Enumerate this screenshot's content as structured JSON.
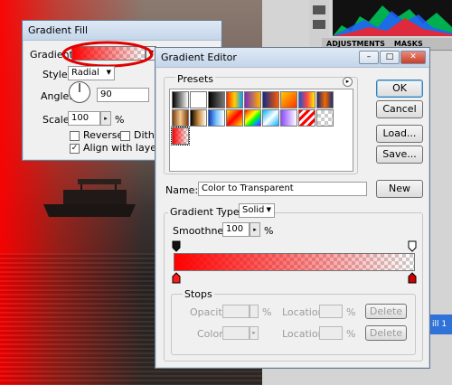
{
  "gradient_fill": {
    "title": "Gradient Fill",
    "gradient_label": "Gradient:",
    "style_label": "Style:",
    "style_value": "Radial",
    "angle_label": "Angle:",
    "angle_value": "90",
    "scale_label": "Scale:",
    "scale_value": "100",
    "scale_unit": "%",
    "reverse_label": "Reverse",
    "dither_label": "Dither",
    "align_label": "Align with layer",
    "reverse_checked": false,
    "dither_checked": false,
    "align_checked": true
  },
  "gradient_editor": {
    "title": "Gradient Editor",
    "presets_label": "Presets",
    "ok_label": "OK",
    "cancel_label": "Cancel",
    "load_label": "Load...",
    "save_label": "Save...",
    "name_label": "Name:",
    "name_value": "Color to Transparent",
    "new_label": "New",
    "gradient_type_label": "Gradient Type:",
    "gradient_type_value": "Solid",
    "smoothness_label": "Smoothness:",
    "smoothness_value": "100",
    "smoothness_unit": "%",
    "stops_label": "Stops",
    "opacity_label": "Opacity:",
    "opacity_unit": "%",
    "location_label": "Location:",
    "location_unit": "%",
    "color_label": "Color:",
    "delete_label": "Delete",
    "preset_swatches": [
      "linear-gradient(90deg,#000,#fff)",
      "linear-gradient(90deg,#fff,rgba(255,255,255,0))",
      "linear-gradient(90deg,#000,#777)",
      "linear-gradient(90deg,#ff2b00,#ffd000,#00a0ff)",
      "linear-gradient(90deg,#7a2cc0,#ffb100)",
      "linear-gradient(90deg,#0f2a8a,#ff5a00)",
      "linear-gradient(135deg,#ffcc00,#ff3300)",
      "linear-gradient(90deg,#1a53d6,#ff4444,#ffee00)",
      "linear-gradient(90deg,#1d2a70,#f26a00,#1d2a70)",
      "linear-gradient(90deg,#7c3e0f,#f5c98f,#7c3e0f)",
      "linear-gradient(90deg,#000,#c98a3a,#fff)",
      "linear-gradient(90deg,#0a3fbf,#7dc4ff,#fff)",
      "linear-gradient(135deg,#ffe400,#ff0000,#ffe400)",
      "linear-gradient(135deg,#ff0000,#ff9900,#ffff00,#00ff00,#0099ff,#9900ff)",
      "linear-gradient(135deg,#00b3ff,#fff,#00b3ff)",
      "linear-gradient(90deg,#8f4aff,#fff)",
      "repeating-linear-gradient(135deg,#ff0000 0,#ff0000 3px,#fff 3px,#fff 6px)",
      "checker",
      "linear-gradient(90deg,#ff0000,rgba(255,0,0,0))"
    ]
  },
  "right_panel": {
    "tab_adjustments": "ADJUSTMENTS",
    "tab_masks": "MASKS",
    "layer_label": "ill 1"
  },
  "colors": {
    "gradient_red": "#ff0000",
    "highlight_ellipse": "#e00000",
    "dialog_bg": "#f0f0f0",
    "titlebar_blue": "#c4d6ea",
    "layer_selected": "#3072d8"
  }
}
